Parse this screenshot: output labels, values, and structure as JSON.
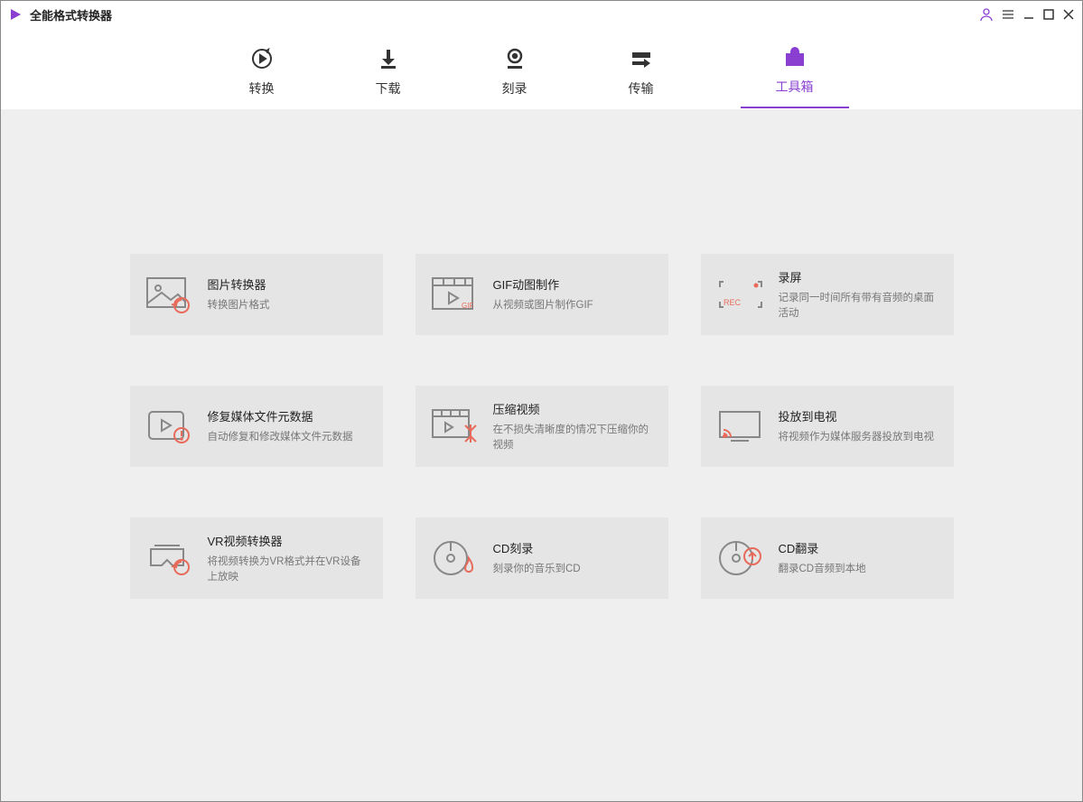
{
  "app": {
    "title": "全能格式转换器"
  },
  "tabs": {
    "convert": "转换",
    "download": "下载",
    "burn": "刻录",
    "transfer": "传输",
    "toolbox": "工具箱"
  },
  "tools": {
    "image_converter": {
      "title": "图片转换器",
      "desc": "转换图片格式"
    },
    "gif_maker": {
      "title": "GIF动图制作",
      "desc": "从视频或图片制作GIF"
    },
    "screen_record": {
      "title": "录屏",
      "desc": "记录同一时间所有带有音频的桌面活动"
    },
    "fix_metadata": {
      "title": "修复媒体文件元数据",
      "desc": "自动修复和修改媒体文件元数据"
    },
    "compress_video": {
      "title": "压缩视频",
      "desc": "在不损失清晰度的情况下压缩你的视频"
    },
    "cast_tv": {
      "title": "投放到电视",
      "desc": "将视频作为媒体服务器投放到电视"
    },
    "vr_converter": {
      "title": "VR视频转换器",
      "desc": "将视频转换为VR格式并在VR设备上放映"
    },
    "cd_burn": {
      "title": "CD刻录",
      "desc": "刻录你的音乐到CD"
    },
    "cd_rip": {
      "title": "CD翻录",
      "desc": "翻录CD音频到本地"
    }
  }
}
